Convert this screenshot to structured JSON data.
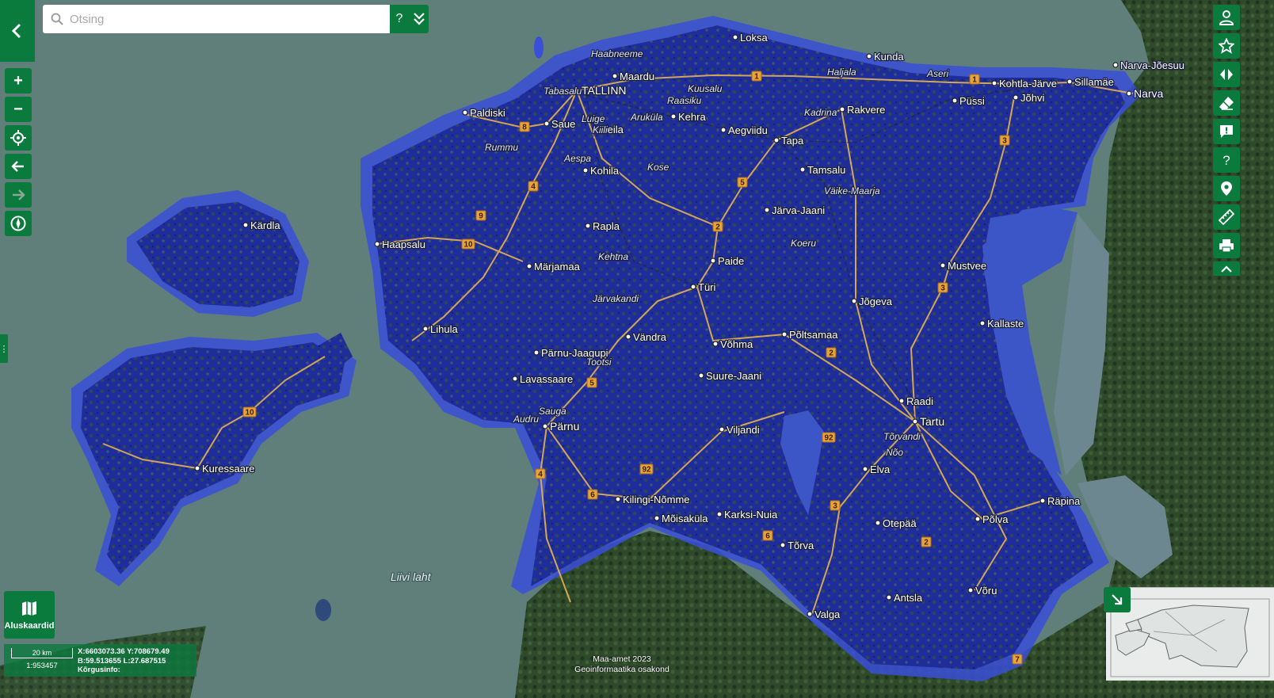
{
  "search": {
    "placeholder": "Otsing",
    "help_label": "?",
    "advanced_icon": "double-chevron-down-icon"
  },
  "left_toolbar": [
    {
      "name": "zoom-in",
      "icon": "plus-icon",
      "glyph": "+"
    },
    {
      "name": "zoom-out",
      "icon": "minus-icon",
      "glyph": "−"
    },
    {
      "name": "locate",
      "icon": "crosshair-icon"
    },
    {
      "name": "history-back",
      "icon": "arrow-left-icon"
    },
    {
      "name": "history-forward",
      "icon": "arrow-right-icon",
      "disabled": true
    },
    {
      "name": "compass",
      "icon": "compass-icon"
    }
  ],
  "right_toolbar": [
    "user-icon",
    "star-icon",
    "compare-icon",
    "eraser-icon",
    "feedback-icon",
    "help-icon",
    "location-pin-icon",
    "ruler-icon",
    "print-icon",
    "chevron-up-icon"
  ],
  "basemaps": {
    "label": "Aluskaardid",
    "icon": "map-icon"
  },
  "scale": {
    "bar_label": "20 km",
    "ratio": "1:953457"
  },
  "coordinates": {
    "xy": "X:6603073.36 Y:708679.49",
    "bl": "B:59.513655 L:27.687515",
    "elevation": "Kõrgusinfo:"
  },
  "attribution": {
    "line1": "Maa-amet 2023",
    "line2": "Geoinformaatika osakond"
  },
  "overview": {
    "toggle_icon": "arrow-down-right-icon"
  },
  "map_labels": {
    "sea": [
      "Liivi laht"
    ],
    "towns": [
      "TALLINN",
      "Maardu",
      "Loksa",
      "Kunda",
      "Narva-Jõesuu",
      "Sillamäe",
      "Narva",
      "Kohtla-Järve",
      "Püssi",
      "Jõhvi",
      "Rakvere",
      "Tapa",
      "Tamsalu",
      "Aegviidu",
      "Kehra",
      "Paldiski",
      "Saue",
      "Keila",
      "Kohila",
      "Rapla",
      "Haapsalu",
      "Kärdla",
      "Märjamaa",
      "Paide",
      "Türi",
      "Järva-Jaani",
      "Mustvee",
      "Jõgeva",
      "Kallaste",
      "Põltsamaa",
      "Võhma",
      "Suure-Jaani",
      "Lihula",
      "Vändra",
      "Pärnu",
      "Viljandi",
      "Tartu",
      "Elva",
      "Räpina",
      "Otepää",
      "Põlva",
      "Tõrva",
      "Valga",
      "Antsla",
      "Võru",
      "Kuressaare",
      "Kilingi-Nõmme",
      "Mõisaküla",
      "Karksi-Nuia",
      "Lavassaare",
      "Pärnu-Jaagupi",
      "Raadi"
    ],
    "villages": [
      "Haabneeme",
      "Tabasalu",
      "Kuusalu",
      "Haljala",
      "Aseri",
      "Raasiku",
      "Aruküla",
      "Kadrina",
      "Luige",
      "Kiili",
      "Rummu",
      "Aespa",
      "Kose",
      "Väike-Maarja",
      "Koeru",
      "Kehtna",
      "Järvakandi",
      "Tootsi",
      "Sauga",
      "Audru",
      "Tõrvandi",
      "Nõo"
    ]
  },
  "road_numbers": [
    "1",
    "1",
    "8",
    "3",
    "5",
    "4",
    "9",
    "2",
    "10",
    "3",
    "2",
    "5",
    "10",
    "92",
    "4",
    "6",
    "92",
    "3",
    "6",
    "2",
    "7"
  ]
}
